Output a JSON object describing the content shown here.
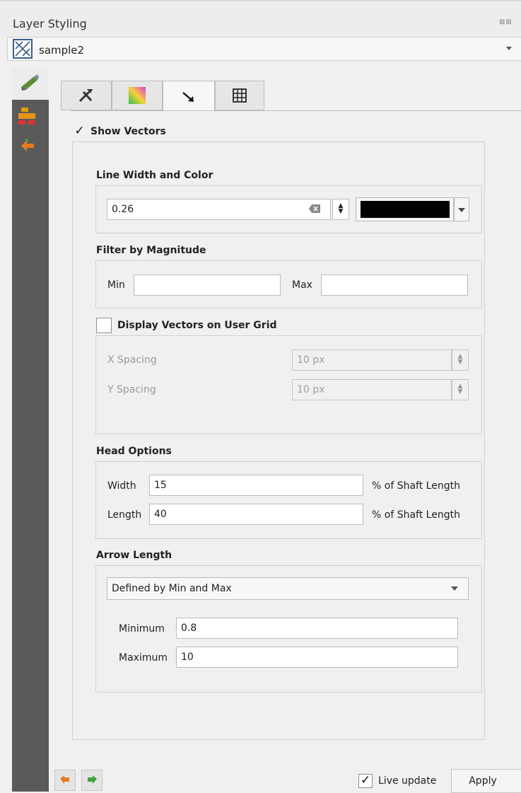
{
  "window": {
    "title": "Layer Styling",
    "float_icons": "⊠⊠"
  },
  "layer_selector": {
    "selected": "sample2"
  },
  "tabs": [
    {
      "name": "settings",
      "icon": "hammer-wrench-icon"
    },
    {
      "name": "color-ramp",
      "icon": "gradient-icon"
    },
    {
      "name": "vectors",
      "icon": "arrow-icon",
      "active": true
    },
    {
      "name": "grid",
      "icon": "grid-icon"
    }
  ],
  "show_vectors": {
    "label": "Show Vectors",
    "checked": true
  },
  "line_width_color": {
    "title": "Line Width and Color",
    "width_value": "0.26",
    "color": "#000000"
  },
  "filter_by_magnitude": {
    "title": "Filter by Magnitude",
    "min_label": "Min",
    "min_value": "",
    "max_label": "Max",
    "max_value": ""
  },
  "user_grid": {
    "label": "Display Vectors on User Grid",
    "checked": false,
    "x_spacing_label": "X Spacing",
    "x_spacing_value": "10 px",
    "y_spacing_label": "Y Spacing",
    "y_spacing_value": "10 px"
  },
  "head_options": {
    "title": "Head Options",
    "width_label": "Width",
    "width_value": "15",
    "width_unit": "% of Shaft Length",
    "length_label": "Length",
    "length_value": "40",
    "length_unit": "% of Shaft Length"
  },
  "arrow_length": {
    "title": "Arrow Length",
    "method": "Defined by Min and Max",
    "minimum_label": "Minimum",
    "minimum_value": "0.8",
    "maximum_label": "Maximum",
    "maximum_value": "10"
  },
  "footer": {
    "live_update_label": "Live update",
    "live_update_checked": true,
    "apply_label": "Apply"
  }
}
